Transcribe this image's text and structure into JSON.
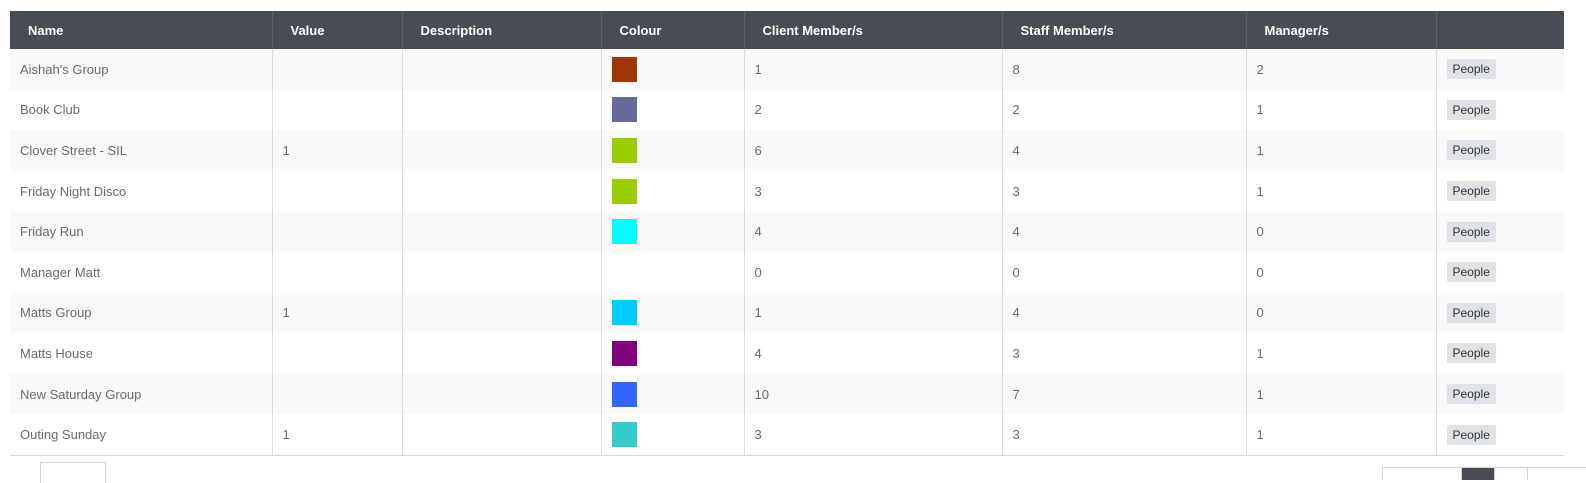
{
  "table": {
    "headers": {
      "name": "Name",
      "value": "Value",
      "description": "Description",
      "colour": "Colour",
      "client": "Client Member/s",
      "staff": "Staff Member/s",
      "managers": "Manager/s",
      "actions": ""
    },
    "action_label": "People",
    "rows": [
      {
        "name": "Aishah's Group",
        "value": "",
        "description": "",
        "colour": "#a0370a",
        "client": "1",
        "staff": "8",
        "managers": "2"
      },
      {
        "name": "Book Club",
        "value": "",
        "description": "",
        "colour": "#676a9b",
        "client": "2",
        "staff": "2",
        "managers": "1"
      },
      {
        "name": "Clover Street - SIL",
        "value": "1",
        "description": "",
        "colour": "#9acc00",
        "client": "6",
        "staff": "4",
        "managers": "1"
      },
      {
        "name": "Friday Night Disco",
        "value": "",
        "description": "",
        "colour": "#9acc00",
        "client": "3",
        "staff": "3",
        "managers": "1"
      },
      {
        "name": "Friday Run",
        "value": "",
        "description": "",
        "colour": "#00ffff",
        "client": "4",
        "staff": "4",
        "managers": "0"
      },
      {
        "name": "Manager Matt",
        "value": "",
        "description": "",
        "colour": "",
        "client": "0",
        "staff": "0",
        "managers": "0"
      },
      {
        "name": "Matts Group",
        "value": "1",
        "description": "",
        "colour": "#00ccff",
        "client": "1",
        "staff": "4",
        "managers": "0"
      },
      {
        "name": "Matts House",
        "value": "",
        "description": "",
        "colour": "#800080",
        "client": "4",
        "staff": "3",
        "managers": "1"
      },
      {
        "name": "New Saturday Group",
        "value": "",
        "description": "",
        "colour": "#3366ff",
        "client": "10",
        "staff": "7",
        "managers": "1"
      },
      {
        "name": "Outing Sunday",
        "value": "1",
        "description": "",
        "colour": "#33cccc",
        "client": "3",
        "staff": "3",
        "managers": "1"
      }
    ]
  }
}
